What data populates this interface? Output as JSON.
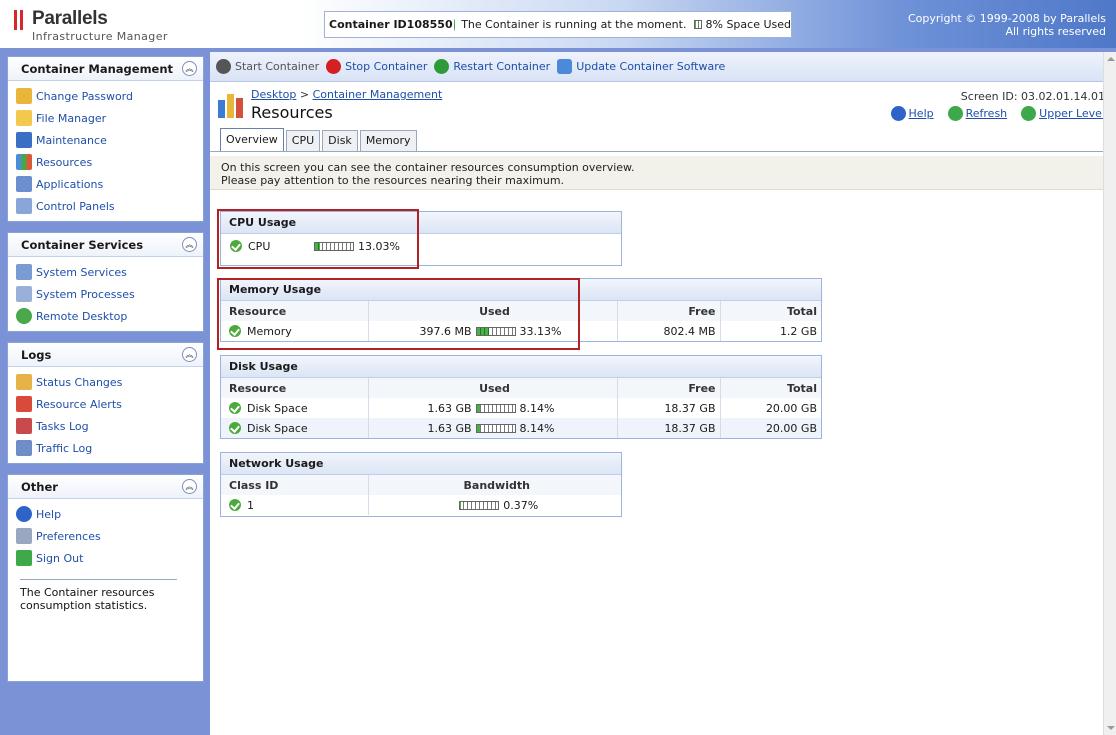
{
  "header": {
    "brand": "Parallels",
    "brand_sub": "Infrastructure Manager",
    "container_id": "Container ID108550",
    "container_status": "The Container is running at the moment.",
    "space_used_pct": 8,
    "space_used_label": "8% Space Used",
    "copyright_line1": "Copyright © 1999-2008 by Parallels",
    "copyright_line2": "All rights reserved"
  },
  "sidebar": {
    "panels": [
      {
        "title": "Container Management",
        "items": [
          "Change Password",
          "File Manager",
          "Maintenance",
          "Resources",
          "Applications",
          "Control Panels"
        ]
      },
      {
        "title": "Container Services",
        "items": [
          "System Services",
          "System Processes",
          "Remote Desktop"
        ]
      },
      {
        "title": "Logs",
        "items": [
          "Status Changes",
          "Resource Alerts",
          "Tasks Log",
          "Traffic Log"
        ]
      },
      {
        "title": "Other",
        "items": [
          "Help",
          "Preferences",
          "Sign Out"
        ]
      }
    ],
    "description": "The Container resources consumption statistics."
  },
  "toolbar": {
    "start": "Start Container",
    "stop": "Stop Container",
    "restart": "Restart Container",
    "update": "Update Container Software"
  },
  "page": {
    "breadcrumb_1": "Desktop",
    "breadcrumb_sep": ">",
    "breadcrumb_2": "Container Management",
    "title": "Resources",
    "screen_id": "Screen ID: 03.02.01.14.01",
    "help": "Help",
    "refresh": "Refresh",
    "upper_level": "Upper Level",
    "tabs": [
      "Overview",
      "CPU",
      "Disk",
      "Memory"
    ],
    "intro_line1": "On this screen you can see the container resources consumption overview.",
    "intro_line2": "Please pay attention to the resources nearing their maximum."
  },
  "cpu": {
    "title": "CPU Usage",
    "name": "CPU",
    "pct": 13.03,
    "label": "13.03%"
  },
  "memory": {
    "title": "Memory Usage",
    "headers": [
      "Resource",
      "Used",
      "Free",
      "Total"
    ],
    "row": {
      "name": "Memory",
      "used": "397.6 MB",
      "pct": 33.13,
      "pct_label": "33.13%",
      "free": "802.4 MB",
      "total": "1.2 GB"
    }
  },
  "disk": {
    "title": "Disk Usage",
    "headers": [
      "Resource",
      "Used",
      "Free",
      "Total"
    ],
    "rows": [
      {
        "name": "Disk Space",
        "used": "1.63 GB",
        "pct": 8.14,
        "pct_label": "8.14%",
        "free": "18.37 GB",
        "total": "20.00 GB"
      },
      {
        "name": "Disk Space",
        "used": "1.63 GB",
        "pct": 8.14,
        "pct_label": "8.14%",
        "free": "18.37 GB",
        "total": "20.00 GB"
      }
    ]
  },
  "network": {
    "title": "Network Usage",
    "headers": [
      "Class ID",
      "Bandwidth"
    ],
    "row": {
      "class_id": "1",
      "pct": 0.37,
      "label": "0.37%"
    }
  }
}
